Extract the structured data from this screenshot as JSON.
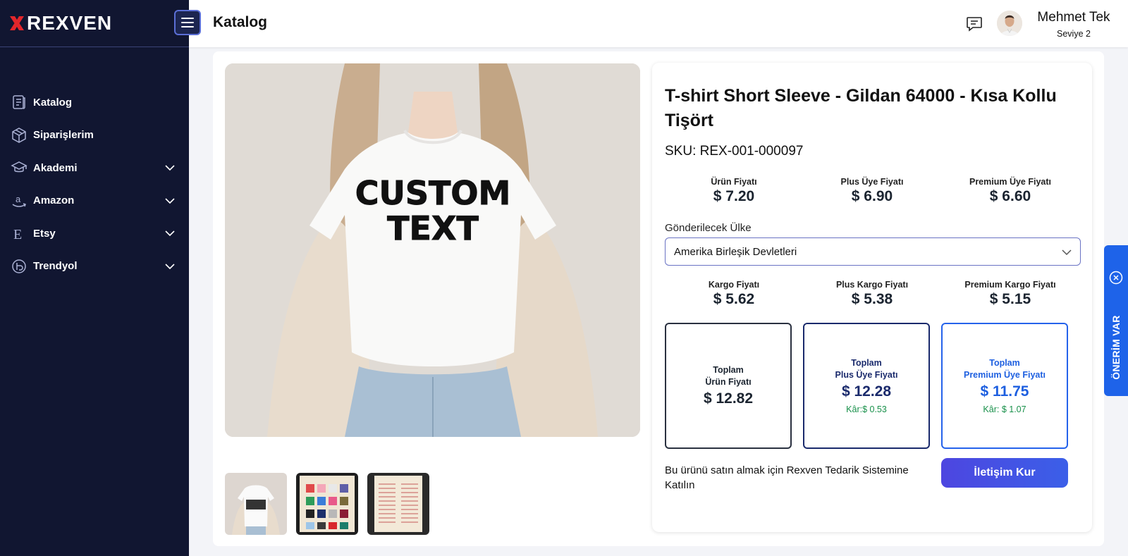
{
  "brand": {
    "name": "REXVEN",
    "accent": "#e3262b"
  },
  "sidebar": {
    "items": [
      {
        "label": "Katalog",
        "icon": "catalog-icon",
        "has_children": false
      },
      {
        "label": "Siparişlerim",
        "icon": "package-icon",
        "has_children": true
      },
      {
        "label": "Akademi",
        "icon": "graduation-cap-icon",
        "has_children": true
      },
      {
        "label": "Amazon",
        "icon": "amazon-icon",
        "has_children": true
      },
      {
        "label": "Etsy",
        "icon": "etsy-icon",
        "has_children": true
      },
      {
        "label": "Trendyol",
        "icon": "trendyol-icon",
        "has_children": true
      }
    ]
  },
  "header": {
    "title": "Katalog",
    "user": {
      "name": "Mehmet Tek",
      "level": "Seviye 2"
    }
  },
  "product": {
    "title": "T-shirt Short Sleeve - Gildan 64000 - Kısa Kollu Tişört",
    "sku": "SKU: REX-001-000097",
    "image_text": [
      "CUSTOM",
      "TEXT"
    ],
    "prices": [
      {
        "label": "Ürün Fiyatı",
        "value": "$ 7.20"
      },
      {
        "label": "Plus Üye Fiyatı",
        "value": "$ 6.90"
      },
      {
        "label": "Premium Üye Fiyatı",
        "value": "$ 6.60"
      }
    ],
    "country": {
      "label": "Gönderilecek Ülke",
      "selected": "Amerika Birleşik Devletleri"
    },
    "shipping": [
      {
        "label": "Kargo Fiyatı",
        "value": "$ 5.62"
      },
      {
        "label": "Plus Kargo Fiyatı",
        "value": "$ 5.38"
      },
      {
        "label": "Premium Kargo Fiyatı",
        "value": "$ 5.15"
      }
    ],
    "totals": [
      {
        "label1": "Toplam",
        "label2": "Ürün Fiyatı",
        "value": "$ 12.82",
        "profit": ""
      },
      {
        "label1": "Toplam",
        "label2": "Plus Üye Fiyatı",
        "value": "$ 12.28",
        "profit": "Kâr:$ 0.53"
      },
      {
        "label1": "Toplam",
        "label2": "Premium Üye Fiyatı",
        "value": "$ 11.75",
        "profit": "Kâr: $ 1.07"
      }
    ],
    "join_text": "Bu ürünü satın almak için Rexven Tedarik Sistemine Katılın",
    "contact_button": "İletişim Kur"
  },
  "side_tab": {
    "label": "ÖNERİM VAR"
  },
  "colors": {
    "sidebar_bg": "#111631",
    "primary_blue": "#1e63e9",
    "profit_green": "#18904a"
  }
}
